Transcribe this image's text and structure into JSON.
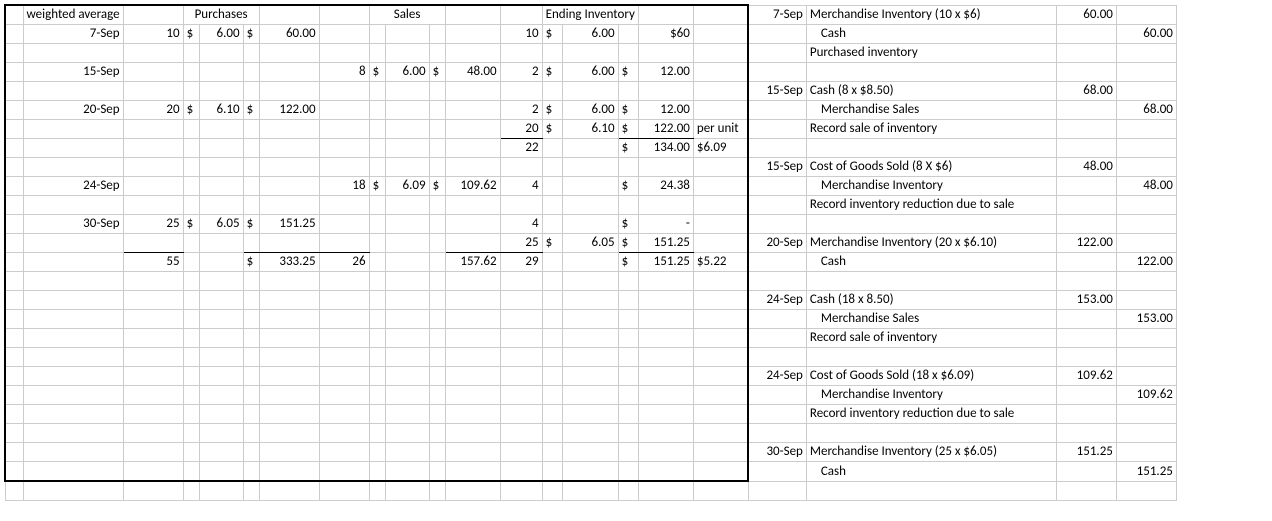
{
  "hdr": {
    "wavg": "weighted average",
    "purch": "Purchases",
    "sales": "Sales",
    "endinv": "Ending Inventory"
  },
  "dates": {
    "d7": "7-Sep",
    "d15": "15-Sep",
    "d20": "20-Sep",
    "d24": "24-Sep",
    "d30": "30-Sep"
  },
  "punit": "per unit",
  "purch": {
    "r7": {
      "q": "10",
      "ds": "$",
      "p": "6.00",
      "ds2": "$",
      "a": "60.00"
    },
    "r20": {
      "q": "20",
      "ds": "$",
      "p": "6.10",
      "ds2": "$",
      "a": "122.00"
    },
    "r30": {
      "q": "25",
      "ds": "$",
      "p": "6.05",
      "ds2": "$",
      "a": "151.25"
    },
    "tot": {
      "q": "55",
      "ds2": "$",
      "a": "333.25"
    }
  },
  "sales": {
    "r15": {
      "q": "8",
      "ds": "$",
      "p": "6.00",
      "ds2": "$",
      "a": "48.00"
    },
    "r24": {
      "q": "18",
      "ds": "$",
      "p": "6.09",
      "ds2": "$",
      "a": "109.62"
    },
    "tot": {
      "q": "26",
      "a": "157.62"
    }
  },
  "inv": {
    "r7": {
      "q": "10",
      "ds": "$",
      "p": "6.00",
      "a": "$60"
    },
    "r15": {
      "q": "2",
      "ds": "$",
      "p": "6.00",
      "ds2": "$",
      "a": "12.00"
    },
    "r20a": {
      "q": "2",
      "ds": "$",
      "p": "6.00",
      "ds2": "$",
      "a": "12.00"
    },
    "r20b": {
      "q": "20",
      "ds": "$",
      "p": "6.10",
      "ds2": "$",
      "a": "122.00"
    },
    "r20c": {
      "q": "22",
      "ds2": "$",
      "a": "134.00",
      "u": "$6.09"
    },
    "r24": {
      "q": "4",
      "ds2": "$",
      "a": "24.38"
    },
    "r30a": {
      "q": "4",
      "ds2": "$",
      "a": "-"
    },
    "r30b": {
      "q": "25",
      "ds": "$",
      "p": "6.05",
      "ds2": "$",
      "a": "151.25"
    },
    "r30c": {
      "q": "29",
      "ds2": "$",
      "a": "151.25",
      "u": "$5.22"
    }
  },
  "je": {
    "e1": {
      "d": "7-Sep",
      "t": "Merchandise Inventory (10  x  $6)",
      "dr": "60.00"
    },
    "e2": {
      "t": "  Cash",
      "cr": "60.00"
    },
    "e3": {
      "t": "Purchased inventory"
    },
    "e4": {
      "d": "15-Sep",
      "t": "Cash (8 x $8.50)",
      "dr": "68.00"
    },
    "e5": {
      "t": "  Merchandise Sales",
      "cr": "68.00"
    },
    "e6": {
      "t": "Record sale of inventory"
    },
    "e7": {
      "d": "15-Sep",
      "t": "Cost of Goods Sold (8  X $6)",
      "dr": "48.00"
    },
    "e8": {
      "t": "  Merchandise Inventory",
      "cr": "48.00"
    },
    "e9": {
      "t": "Record inventory reduction due to sale"
    },
    "e10": {
      "d": "20-Sep",
      "t": "Merchandise Inventory (20  x $6.10)",
      "dr": "122.00"
    },
    "e11": {
      "t": "  Cash",
      "cr": "122.00"
    },
    "e12": {
      "d": "24-Sep",
      "t": "Cash (18 x 8.50)",
      "dr": "153.00"
    },
    "e13": {
      "t": "  Merchandise Sales",
      "cr": "153.00"
    },
    "e14": {
      "t": "Record sale of inventory"
    },
    "e15": {
      "d": "24-Sep",
      "t": "Cost of Goods Sold (18 x $6.09)",
      "dr": "109.62"
    },
    "e16": {
      "t": "  Merchandise Inventory",
      "cr": "109.62"
    },
    "e17": {
      "t": "Record inventory reduction due to sale"
    },
    "e18": {
      "d": "30-Sep",
      "t": "Merchandise Inventory (25  x $6.05)",
      "dr": "151.25"
    },
    "e19": {
      "t": "  Cash",
      "cr": "151.25"
    }
  }
}
